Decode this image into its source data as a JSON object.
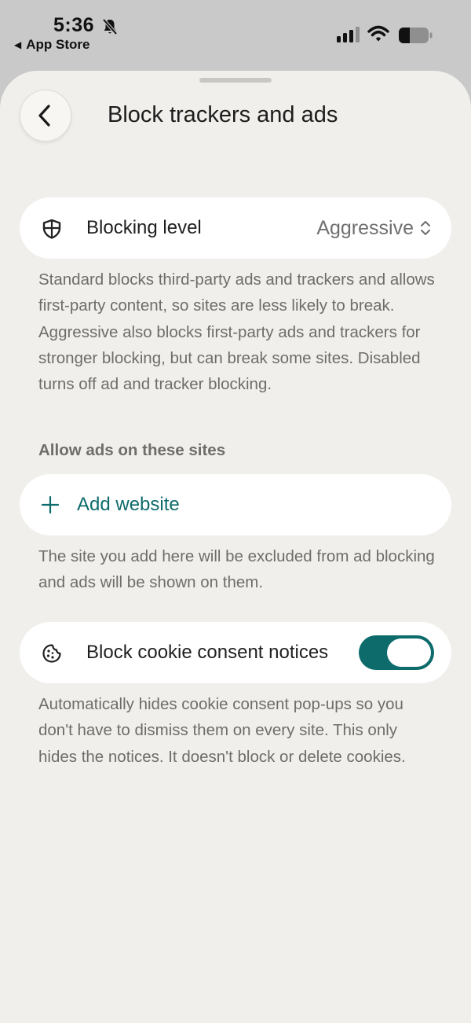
{
  "status_bar": {
    "time": "5:36",
    "back_app": "App Store",
    "icons": [
      "bell-slash-icon",
      "signal-icon",
      "wifi-icon",
      "battery-icon"
    ]
  },
  "header": {
    "title": "Block trackers and ads",
    "back_icon": "chevron-left-icon"
  },
  "blocking": {
    "label": "Blocking level",
    "value": "Aggressive",
    "icon": "shield-icon",
    "description": "Standard blocks third-party ads and trackers and allows first-party content, so sites are less likely to break. Aggressive also blocks first-party ads and trackers for stronger blocking, but can break some sites. Disabled turns off ad and tracker blocking."
  },
  "allow_ads": {
    "section_label": "Allow ads on these sites",
    "add_label": "Add website",
    "description": "The site you add here will be excluded from ad blocking and ads will be shown on them."
  },
  "cookies": {
    "label": "Block cookie consent notices",
    "icon": "cookie-icon",
    "enabled": true,
    "description": "Automatically hides cookie consent pop-ups so you don't have to dismiss them on every site. This only hides the notices. It doesn't block or delete cookies."
  },
  "colors": {
    "accent": "#0e6b6b",
    "sheet_bg": "#f0efeb",
    "card_bg": "#ffffff",
    "muted_text": "#6e6d69"
  }
}
